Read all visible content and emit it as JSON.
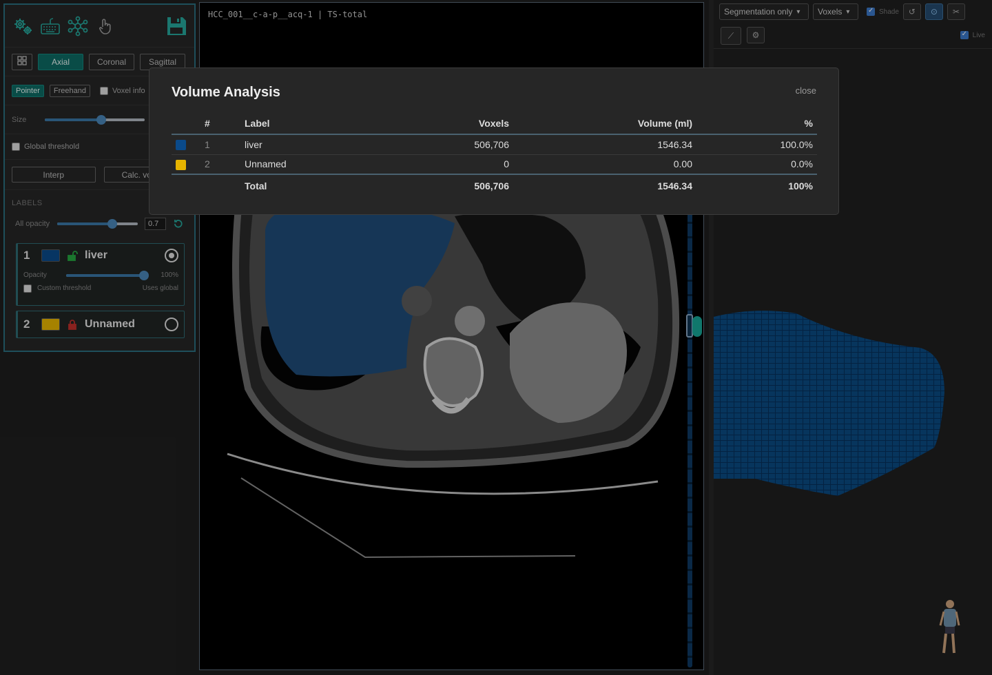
{
  "viewer": {
    "title": "HCC_001__c-a-p__acq-1 | TS-total"
  },
  "views": {
    "axial": "Axial",
    "coronal": "Coronal",
    "sagittal": "Sagittal",
    "active": "Axial"
  },
  "tools": {
    "pointer": "Pointer",
    "freehand": "Freehand",
    "voxel_info": "Voxel info"
  },
  "size": {
    "label": "Size",
    "value_fraction": 0.6
  },
  "global_threshold": "Global threshold",
  "actions": {
    "interp": "Interp",
    "calc_volume": "Calc. volume"
  },
  "labels_section": {
    "title": "LABELS",
    "add": "+",
    "all_opacity_label": "All opacity",
    "all_opacity_value": "0.7"
  },
  "labels": [
    {
      "id": "1",
      "name": "liver",
      "color": "#0a4a8a",
      "locked": false,
      "active": true,
      "opacity_label": "Opacity",
      "opacity_value": "100%",
      "custom_threshold": "Custom threshold",
      "uses_global": "Uses global"
    },
    {
      "id": "2",
      "name": "Unnamed",
      "color": "#e6b400",
      "locked": true,
      "active": false
    }
  ],
  "right_panel": {
    "mode_select": "Segmentation only",
    "render_select": "Voxels",
    "shade_label": "Shade",
    "live_label": "Live"
  },
  "modal": {
    "title": "Volume Analysis",
    "close": "close",
    "columns": {
      "idx": "#",
      "label": "Label",
      "voxels": "Voxels",
      "volume": "Volume (ml)",
      "pct": "%"
    },
    "rows": [
      {
        "color": "#0a4a8a",
        "idx": "1",
        "label": "liver",
        "voxels": "506,706",
        "volume": "1546.34",
        "pct": "100.0%"
      },
      {
        "color": "#e6b400",
        "idx": "2",
        "label": "Unnamed",
        "voxels": "0",
        "volume": "0.00",
        "pct": "0.0%"
      }
    ],
    "total": {
      "label": "Total",
      "voxels": "506,706",
      "volume": "1546.34",
      "pct": "100%"
    }
  }
}
